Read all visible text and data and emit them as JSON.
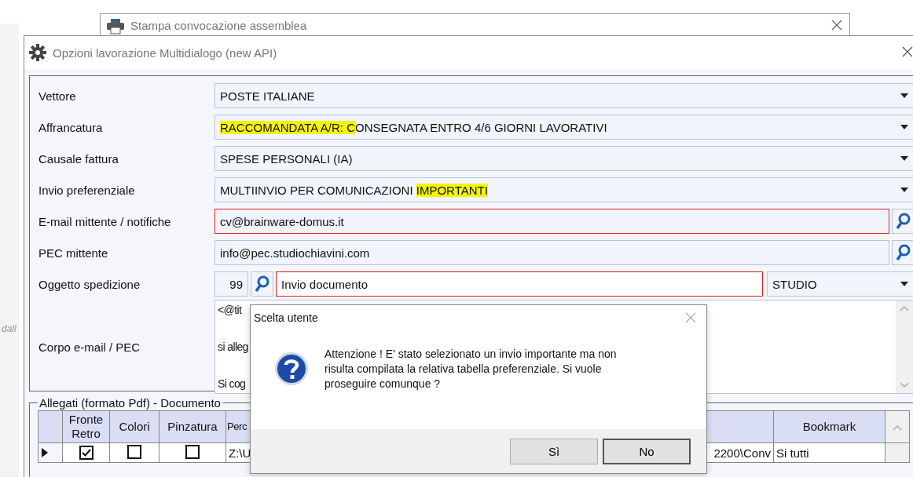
{
  "background_app": {
    "text": "dall"
  },
  "back_window": {
    "title": "Stampa convocazione assemblea"
  },
  "window": {
    "title": "Opzioni lavorazione Multidialogo (new API)"
  },
  "form": {
    "fields": [
      {
        "label": "Vettore",
        "kind": "dropdown",
        "invalid": false,
        "value": [
          {
            "text": "POSTE ITALIANE",
            "highlighted": false
          }
        ]
      },
      {
        "label": "Affrancatura",
        "kind": "dropdown",
        "invalid": false,
        "value": [
          {
            "text": "RACCOMANDATA A/R: C",
            "highlighted": true
          },
          {
            "text": "ONSEGNATA ENTRO 4/6 GIORNI LAVORATIVI",
            "highlighted": false
          }
        ]
      },
      {
        "label": "Causale fattura",
        "kind": "dropdown",
        "invalid": false,
        "value": [
          {
            "text": "SPESE PERSONALI (IA)",
            "highlighted": false
          }
        ]
      },
      {
        "label": "Invio preferenziale",
        "kind": "dropdown",
        "invalid": false,
        "value": [
          {
            "text": "MULTIINVIO PER COMUNICAZIONI ",
            "highlighted": false
          },
          {
            "text": "IMPORTANTI",
            "highlighted": true
          }
        ]
      },
      {
        "label": "E-mail mittente / notifiche",
        "kind": "lookup",
        "invalid": true,
        "value": "cv@brainware-domus.it"
      },
      {
        "label": "PEC mittente",
        "kind": "lookup",
        "invalid": false,
        "value": "info@pec.studiochiavini.com"
      },
      {
        "label": "Oggetto spedizione",
        "kind": "subject",
        "code": "99",
        "value": "Invio documento",
        "invalid": true,
        "option": "STUDIO"
      },
      {
        "label": "Corpo e-mail / PEC",
        "kind": "textarea",
        "lines": [
          "<@tit",
          "si alleg",
          "Si cog"
        ]
      }
    ]
  },
  "attachments": {
    "legend": "Allegati (formato Pdf) - Documento",
    "columns": [
      {
        "label": "Fronte Retro"
      },
      {
        "label": "Colori"
      },
      {
        "label": "Pinzatura"
      },
      {
        "label": "Perc"
      },
      {
        "label": "Bookmark"
      }
    ],
    "rows": [
      {
        "selected": true,
        "fronte_retro": true,
        "colori": false,
        "pinzatura": false,
        "path_start": "Z:\\U",
        "path_end": "2200\\Conv",
        "bookmark": "Si tutti"
      }
    ]
  },
  "dialog": {
    "title": "Scelta utente",
    "message": "Attenzione ! E' stato selezionato un invio importante ma non risulta compilata la relativa tabella preferenziale. Si vuole proseguire comunque ?",
    "buttons": [
      {
        "label": "Sì",
        "default": false
      },
      {
        "label": "No",
        "default": true
      }
    ]
  }
}
